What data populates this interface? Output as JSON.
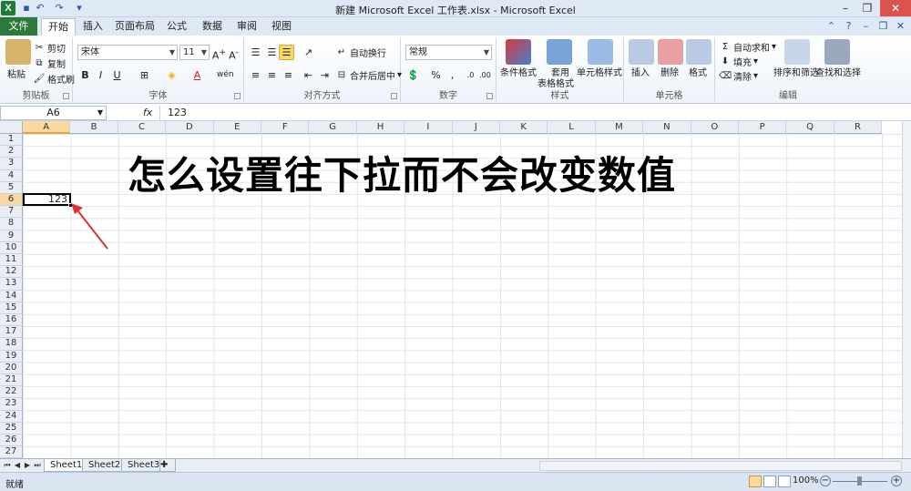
{
  "window": {
    "title": "新建 Microsoft Excel 工作表.xlsx  -  Microsoft Excel",
    "app_icon": "X"
  },
  "tabs": [
    {
      "label": "文件"
    },
    {
      "label": "开始"
    },
    {
      "label": "插入"
    },
    {
      "label": "页面布局"
    },
    {
      "label": "公式"
    },
    {
      "label": "数据"
    },
    {
      "label": "审阅"
    },
    {
      "label": "视图"
    }
  ],
  "ribbon": {
    "clipboard": {
      "paste": "粘贴",
      "cut": "剪切",
      "copy": "复制",
      "format_painter": "格式刷",
      "label": "剪贴板"
    },
    "font": {
      "name": "宋体",
      "size": "11",
      "bold": "B",
      "italic": "I",
      "underline": "U",
      "label": "字体",
      "phonetic": "wén"
    },
    "alignment": {
      "wrap": "自动换行",
      "merge": "合并后居中",
      "label": "对齐方式"
    },
    "number": {
      "format": "常规",
      "percent": "%",
      "label": "数字"
    },
    "styles": {
      "conditional": "条件格式",
      "table_format_1": "套用",
      "table_format_2": "表格格式",
      "cell_styles": "单元格样式",
      "label": "样式"
    },
    "cells": {
      "insert": "插入",
      "delete": "删除",
      "format": "格式",
      "label": "单元格"
    },
    "editing": {
      "autosum": "自动求和",
      "fill": "填充",
      "clear": "清除",
      "sort": "排序和筛选",
      "find": "查找和选择",
      "label": "编辑"
    }
  },
  "formula_bar": {
    "name_box": "A6",
    "fx": "fx",
    "value": "123"
  },
  "columns": [
    "A",
    "B",
    "C",
    "D",
    "E",
    "F",
    "G",
    "H",
    "I",
    "J",
    "K",
    "L",
    "M",
    "N",
    "O",
    "P",
    "Q",
    "R"
  ],
  "rows": [
    "1",
    "2",
    "3",
    "4",
    "5",
    "6",
    "7",
    "8",
    "9",
    "10",
    "11",
    "12",
    "13",
    "14",
    "15",
    "16",
    "17",
    "18",
    "19",
    "20",
    "21",
    "22",
    "23",
    "24",
    "25",
    "26",
    "27"
  ],
  "sheet": {
    "headline": "怎么设置往下拉而不会改变数值",
    "active_cell_value": "123"
  },
  "sheet_tabs": [
    "Sheet1",
    "Sheet2",
    "Sheet3"
  ],
  "status": {
    "mode": "就绪",
    "zoom": "100%"
  },
  "colors": {
    "file_tab": "#2b7a3b",
    "selection_header": "#f9d99f",
    "accent_arrow": "#e03030"
  }
}
